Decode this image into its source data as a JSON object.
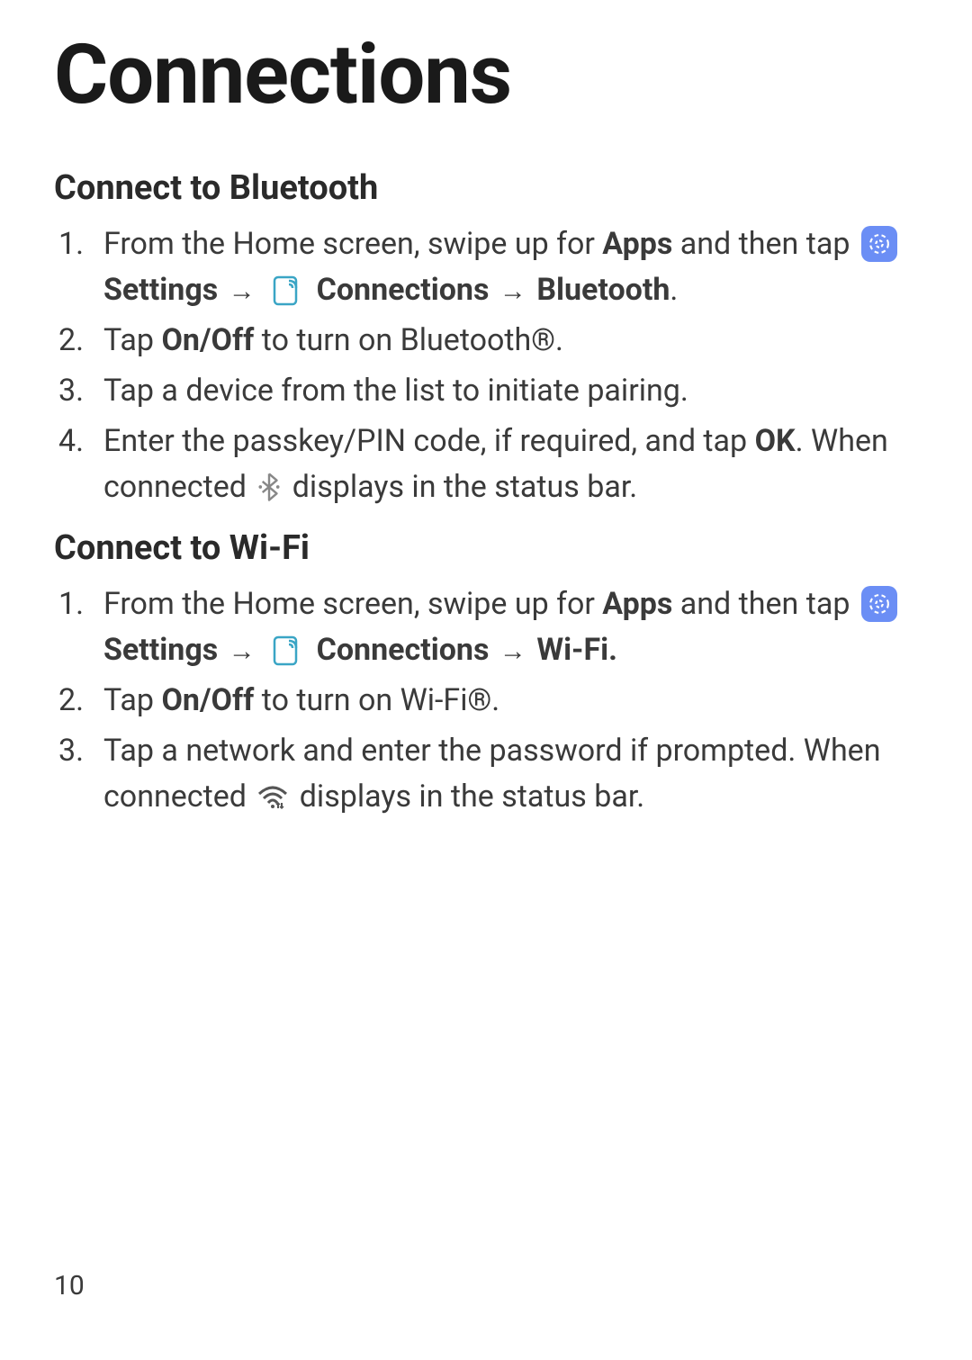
{
  "page": {
    "title": "Connections",
    "number": "10"
  },
  "sections": {
    "bluetooth": {
      "heading": "Connect to Bluetooth",
      "step1_pre": "From the Home screen, swipe up for ",
      "step1_apps": "Apps",
      "step1_mid": " and then tap ",
      "step1_settings": "Settings",
      "step1_connections": "Connections",
      "step1_bluetooth": "Bluetooth",
      "step1_period": ".",
      "step2_pre": "Tap ",
      "step2_onoff": "On/Off",
      "step2_post": " to turn on Bluetooth®.",
      "step3": "Tap a device from the list to initiate pairing.",
      "step4_pre": "Enter the passkey/PIN code, if required, and tap ",
      "step4_ok": "OK",
      "step4_post": ". When connected ",
      "step4_end": " displays in the status bar."
    },
    "wifi": {
      "heading": "Connect to Wi-Fi",
      "step1_pre": "From the Home screen, swipe up for ",
      "step1_apps": "Apps",
      "step1_mid": " and then tap ",
      "step1_settings": "Settings",
      "step1_connections": "Connections",
      "step1_wifi": "Wi-Fi.",
      "step2_pre": "Tap ",
      "step2_onoff": "On/Off",
      "step2_post": " to turn on Wi-Fi®.",
      "step3_pre": "Tap a network and enter the password if prompted. When connected ",
      "step3_end": " displays in the status bar."
    }
  },
  "arrow": "→"
}
